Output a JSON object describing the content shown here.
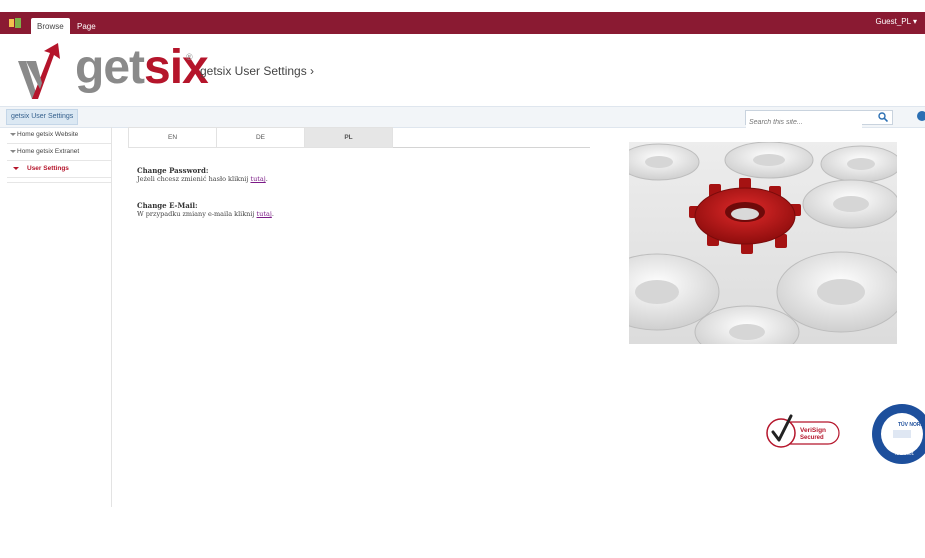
{
  "ribbon": {
    "tabs": [
      {
        "label": "Browse"
      },
      {
        "label": "Page"
      }
    ],
    "user": "Guest_PL ▾"
  },
  "header": {
    "logo_text_gray": "get",
    "logo_text_red": "six",
    "logo_reg": "®",
    "site_title": "getsix User Settings ›"
  },
  "breadcrumb": {
    "label": "getsix User Settings"
  },
  "search": {
    "placeholder": "Search this site..."
  },
  "leftnav": {
    "items": [
      {
        "label": "Home getsix Website"
      },
      {
        "label": "Home getsix Extranet"
      },
      {
        "label": "User Settings"
      }
    ]
  },
  "languages": {
    "tabs": [
      {
        "label": "EN"
      },
      {
        "label": "DE"
      },
      {
        "label": "PL"
      }
    ],
    "selected": "PL"
  },
  "content": {
    "password": {
      "title": "Change Password:",
      "text": "Jeżeli chcesz zmienić hasło kliknij ",
      "link": "tutaj",
      "after": "."
    },
    "email": {
      "title": "Change E-Mail:",
      "text": "W przypadku zmiany e-maila kliknij ",
      "link": "tutaj",
      "after": "."
    }
  },
  "badges": {
    "verisign_line1": "VeriSign",
    "verisign_line2": "Secured",
    "tuv_line1": "TÜV NORD",
    "tuv_line2": "ISO 9001"
  },
  "colors": {
    "ribbon": "#8a1a32",
    "brand_red": "#b5152b",
    "link": "#7b1a86"
  }
}
